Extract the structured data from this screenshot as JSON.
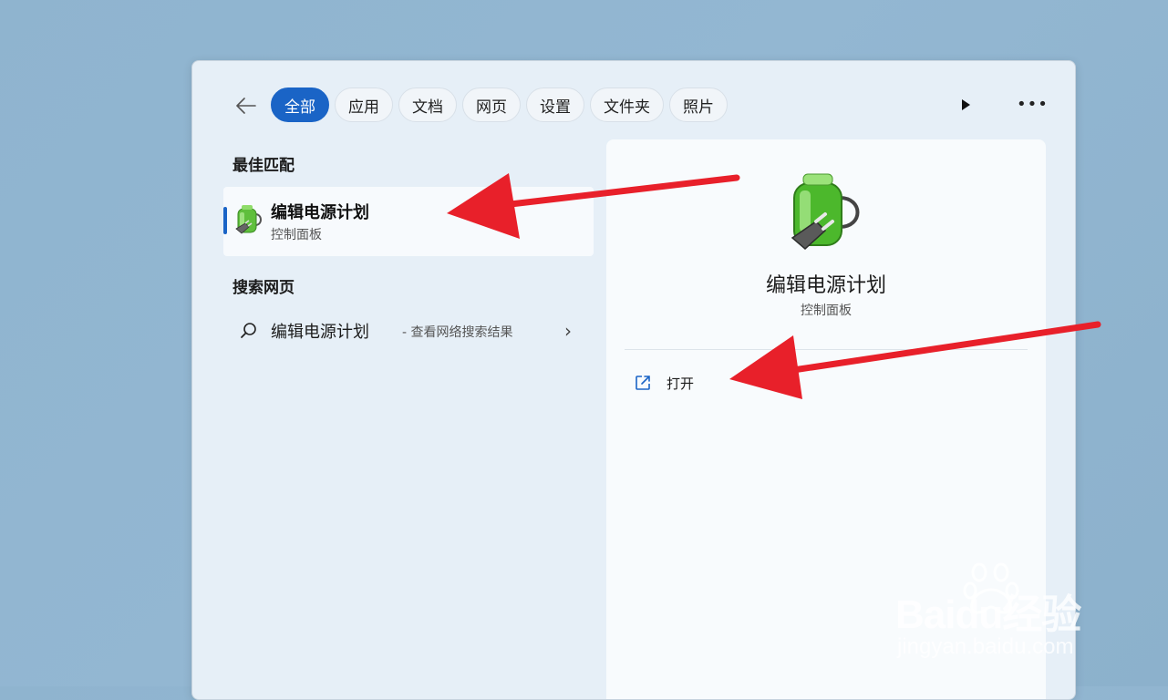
{
  "filters": {
    "chips": [
      {
        "label": "全部",
        "active": true
      },
      {
        "label": "应用",
        "active": false
      },
      {
        "label": "文档",
        "active": false
      },
      {
        "label": "网页",
        "active": false
      },
      {
        "label": "设置",
        "active": false
      },
      {
        "label": "文件夹",
        "active": false
      },
      {
        "label": "照片",
        "active": false
      }
    ]
  },
  "best_match": {
    "heading": "最佳匹配",
    "title": "编辑电源计划",
    "subtitle": "控制面板",
    "icon": "power-plan-icon"
  },
  "web_search": {
    "heading": "搜索网页",
    "query": "编辑电源计划",
    "hint": "- 查看网络搜索结果"
  },
  "detail": {
    "title": "编辑电源计划",
    "subtitle": "控制面板",
    "action": "打开"
  },
  "watermark": {
    "brand": "Baidu经验",
    "url": "jingyan.baidu.com"
  },
  "colors": {
    "accent": "#1a64c6",
    "arrow": "#e8202a"
  }
}
